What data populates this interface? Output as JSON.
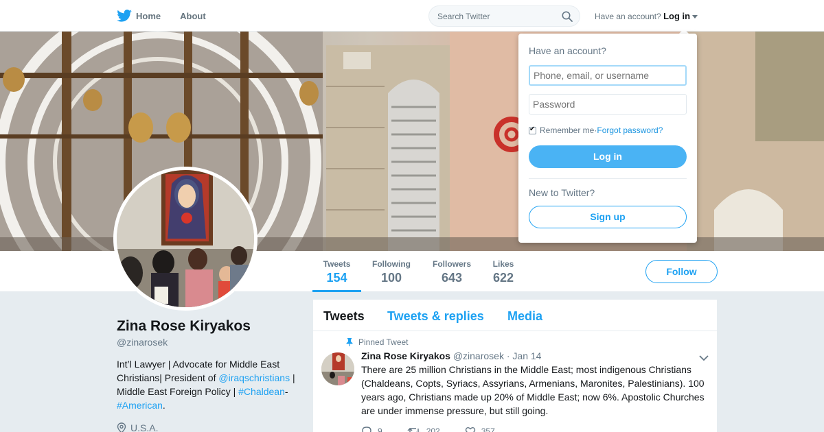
{
  "nav": {
    "home": "Home",
    "about": "About",
    "search_placeholder": "Search Twitter",
    "have_account": "Have an account?",
    "login": "Log in"
  },
  "profile": {
    "name": "Zina Rose Kiryakos",
    "handle": "@zinarosek",
    "bio_1": "Int’l Lawyer | Advocate for Middle East Christians| President of ",
    "bio_link_1": "@iraqschristians",
    "bio_2": " | Middle East Foreign Policy | ",
    "bio_link_2": "#Chaldean",
    "bio_3": "-",
    "bio_link_3": "#American",
    "bio_4": ".",
    "location": "U.S.A."
  },
  "stats": [
    {
      "label": "Tweets",
      "value": "154"
    },
    {
      "label": "Following",
      "value": "100"
    },
    {
      "label": "Followers",
      "value": "643"
    },
    {
      "label": "Likes",
      "value": "622"
    }
  ],
  "follow_button": "Follow",
  "tabs": [
    "Tweets",
    "Tweets & replies",
    "Media"
  ],
  "tweet": {
    "pinned_label": "Pinned Tweet",
    "author": "Zina Rose Kiryakos",
    "handle": "@zinarosek",
    "date": "· Jan 14",
    "text": "There are 25 million Christians in the Middle East; most indigenous Christians (Chaldeans, Copts, Syriacs, Assyrians, Armenians, Maronites, Palestinians). 100 years ago, Christians made up 20% of Middle East; now 6%. Apostolic Churches are under immense pressure, but still going.",
    "replies": "9",
    "retweets": "202",
    "likes": "357"
  },
  "login_dropdown": {
    "title": "Have an account?",
    "username_placeholder": "Phone, email, or username",
    "password_placeholder": "Password",
    "remember_me": "Remember me",
    "separator": " · ",
    "forgot_password": "Forgot password?",
    "login_button": "Log in",
    "new_to_twitter": "New to Twitter?",
    "signup_button": "Sign up"
  },
  "colors": {
    "accent": "#1da1f2",
    "login_button": "#4ab3f4"
  }
}
